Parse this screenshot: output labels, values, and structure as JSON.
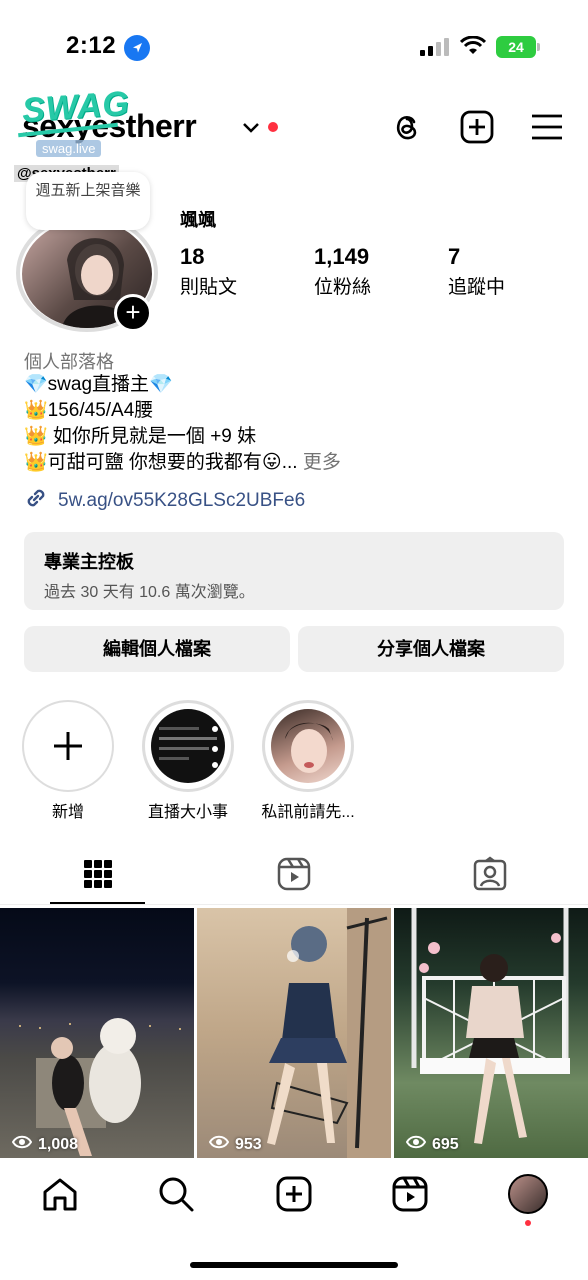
{
  "status": {
    "time": "2:12",
    "battery": "24"
  },
  "header": {
    "username": "sexyesther",
    "username_tail": "r",
    "swag_logo": "SWAG",
    "swag_sub": "swag.live",
    "watermark": "@sexyestherr"
  },
  "profile": {
    "note": "週五新上架音樂",
    "display_name": "颯颯",
    "stats": [
      {
        "num": "18",
        "label": "則貼文"
      },
      {
        "num": "1,149",
        "label": "位粉絲"
      },
      {
        "num": "7",
        "label": "追蹤中"
      }
    ],
    "category": "個人部落格",
    "bio": [
      "💎swag直播主💎",
      "👑156/45/A4腰",
      "👑 如你所見就是一個 +9 妹",
      "👑可甜可鹽 你想要的我都有😛..."
    ],
    "bio_more": "更多",
    "link": "5w.ag/ov55K28GLSc2UBFe6"
  },
  "dashboard": {
    "title": "專業主控板",
    "subtitle": "過去 30 天有 10.6 萬次瀏覽。"
  },
  "buttons": {
    "edit": "編輯個人檔案",
    "share": "分享個人檔案"
  },
  "highlights": [
    {
      "label": "新增"
    },
    {
      "label": "直播大小事"
    },
    {
      "label": "私訊前請先..."
    }
  ],
  "posts": [
    {
      "views": "1,008"
    },
    {
      "views": "953"
    },
    {
      "views": "695"
    }
  ],
  "colors": {
    "accent_red": "#ff3040",
    "link": "#385185",
    "swag": "#27c9a7",
    "location": "#1877f2",
    "battery": "#2ecc40"
  },
  "icons": [
    "location-arrow-icon",
    "signal-icon",
    "wifi-icon",
    "battery-icon",
    "threads-icon",
    "create-icon",
    "menu-icon",
    "link-icon",
    "grid-icon",
    "reels-icon",
    "tagged-icon",
    "home-icon",
    "search-icon",
    "add-post-icon",
    "reels-nav-icon",
    "eye-icon"
  ]
}
